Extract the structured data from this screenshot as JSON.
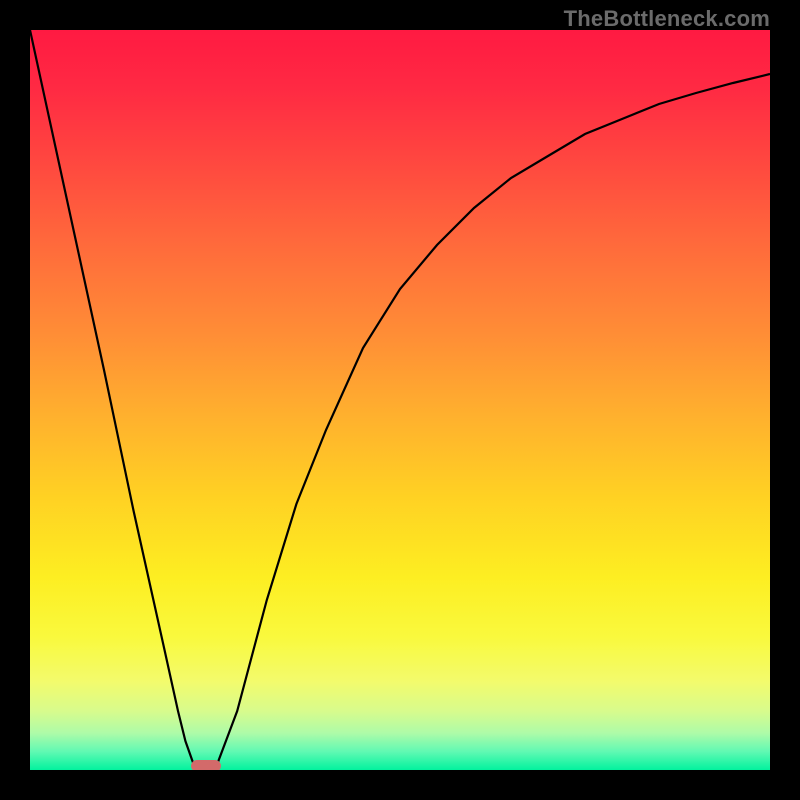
{
  "watermark": "TheBottleneck.com",
  "chart_data": {
    "type": "line",
    "title": "",
    "xlabel": "",
    "ylabel": "",
    "xlim": [
      0,
      100
    ],
    "ylim": [
      0,
      100
    ],
    "series": [
      {
        "name": "curve",
        "x": [
          0,
          5,
          10,
          14,
          18,
          20,
          21,
          22,
          23,
          25,
          28,
          32,
          36,
          40,
          45,
          50,
          55,
          60,
          65,
          70,
          75,
          80,
          85,
          90,
          95,
          100
        ],
        "values": [
          100,
          77,
          54,
          35,
          17,
          8,
          4,
          1,
          0,
          0,
          8,
          23,
          36,
          46,
          57,
          65,
          71,
          76,
          80,
          83,
          86,
          88,
          90,
          91.5,
          92.8,
          94
        ]
      }
    ],
    "marker": {
      "x_range": [
        22,
        26
      ],
      "y": 0
    },
    "gradient_stops": [
      {
        "pos": 0,
        "color": "#ff1a42"
      },
      {
        "pos": 0.5,
        "color": "#ffb02e"
      },
      {
        "pos": 0.82,
        "color": "#f9f93d"
      },
      {
        "pos": 1.0,
        "color": "#02f29e"
      }
    ]
  }
}
